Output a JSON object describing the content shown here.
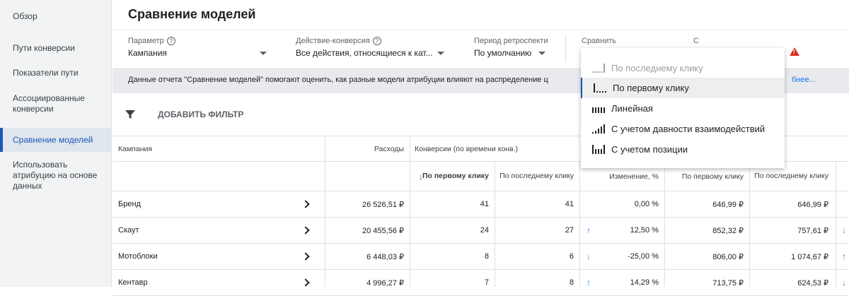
{
  "sidebar": {
    "items": [
      {
        "label": "Обзор"
      },
      {
        "label": "Пути конверсии"
      },
      {
        "label": "Показатели пути"
      },
      {
        "label": "Ассоциированные конверсии"
      },
      {
        "label": "Сравнение моделей",
        "active": true
      },
      {
        "label": "Использовать атрибуцию на основе данных"
      }
    ]
  },
  "header": {
    "title": "Сравнение моделей",
    "params": [
      {
        "label": "Параметр",
        "value": "Кампания"
      },
      {
        "label": "Действие-конверсия",
        "value": "Все действия, относящиеся к кат..."
      },
      {
        "label": "Период ретроспекти",
        "value": "По умолчанию"
      },
      {
        "label": "Сравнить",
        "value": ""
      },
      {
        "label": "С",
        "value": ""
      }
    ]
  },
  "infobar": {
    "text": "Данные отчета \"Сравнение моделей\" помогают оценить, как разные модели атрибуции влияют на распределение ц",
    "link": "бнее..."
  },
  "filter": {
    "label": "ДОБАВИТЬ ФИЛЬТР"
  },
  "table": {
    "headers": {
      "campaign": "Кампания",
      "spend": "Расходы",
      "conversions": "Конверсии (по времени конв.)",
      "first_click": "По первому клику",
      "last_click": "По последнему клику",
      "change": "Изменение, %",
      "first_click2": "По первому клику",
      "last_click2": "По последнему клику"
    },
    "rows": [
      {
        "name": "Бренд",
        "spend": "26 526,51 ₽",
        "first": "41",
        "last": "41",
        "trend": "",
        "change": "0,00 %",
        "cost_first": "646,99 ₽",
        "cost_last": "646,99 ₽",
        "trend2": ""
      },
      {
        "name": "Скаут",
        "spend": "20 455,56 ₽",
        "first": "24",
        "last": "27",
        "trend": "↑",
        "change": "12,50 %",
        "cost_first": "852,32 ₽",
        "cost_last": "757,61 ₽",
        "trend2": "↓"
      },
      {
        "name": "Мотоблоки",
        "spend": "6 448,03 ₽",
        "first": "8",
        "last": "6",
        "trend": "↓",
        "change": "-25,00 %",
        "cost_first": "806,00 ₽",
        "cost_last": "1 074,67 ₽",
        "trend2": "↑"
      },
      {
        "name": "Кентавр",
        "spend": "4 996,27 ₽",
        "first": "7",
        "last": "8",
        "trend": "↑",
        "change": "14,29 %",
        "cost_first": "713,75 ₽",
        "cost_last": "624,53 ₽",
        "trend2": "↓"
      }
    ]
  },
  "dropdown": {
    "items": [
      {
        "label": "По последнему клику",
        "icon": "last-click-model-icon",
        "state": "disabled"
      },
      {
        "label": "По первому клику",
        "icon": "first-click-model-icon",
        "state": "selected"
      },
      {
        "label": "Линейная",
        "icon": "linear-model-icon",
        "state": ""
      },
      {
        "label": "С учетом давности взаимодействий",
        "icon": "time-decay-model-icon",
        "state": ""
      },
      {
        "label": "С учетом позиции",
        "icon": "position-based-model-icon",
        "state": ""
      }
    ]
  },
  "colors": {
    "accent": "#1a56b8",
    "link": "#1a73e8",
    "warning": "#d93025",
    "sidebar_bg": "#f1f3f4",
    "infobar_bg": "#e8eaed"
  }
}
